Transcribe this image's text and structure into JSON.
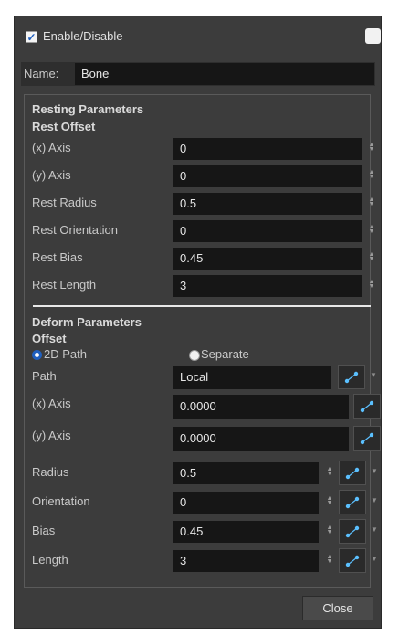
{
  "enable": {
    "label": "Enable/Disable",
    "checked": true
  },
  "name": {
    "label": "Name:",
    "value": "Bone"
  },
  "resting": {
    "title": "Resting Parameters",
    "subtitle": "Rest Offset",
    "rows": [
      {
        "label": "(x) Axis",
        "value": "0"
      },
      {
        "label": "(y) Axis",
        "value": "0"
      },
      {
        "label": "Rest Radius",
        "value": "0.5"
      },
      {
        "label": "Rest Orientation",
        "value": "0"
      },
      {
        "label": "Rest Bias",
        "value": "0.45"
      },
      {
        "label": "Rest Length",
        "value": "3"
      }
    ]
  },
  "deform": {
    "title": "Deform Parameters",
    "subtitle": "Offset",
    "radio_2d": "2D Path",
    "radio_separate": "Separate",
    "selected_mode": "2D Path",
    "path": {
      "label": "Path",
      "value": "Local"
    },
    "x_axis": {
      "label": "(x) Axis",
      "value": "0.0000"
    },
    "y_axis": {
      "label": "(y) Axis",
      "value": "0.0000"
    },
    "radius": {
      "label": "Radius",
      "value": "0.5"
    },
    "orientation": {
      "label": "Orientation",
      "value": "0"
    },
    "bias": {
      "label": "Bias",
      "value": "0.45"
    },
    "length": {
      "label": "Length",
      "value": "3"
    }
  },
  "close_label": "Close",
  "icons": {
    "function": "function-curve-icon",
    "spinner": "spinner-arrows-icon",
    "dropdown": "dropdown-arrow-icon"
  },
  "colors": {
    "panel": "#3c3c3c",
    "field": "#161616",
    "accent": "#1f5fbf",
    "function_icon": "#5bc0ff"
  }
}
